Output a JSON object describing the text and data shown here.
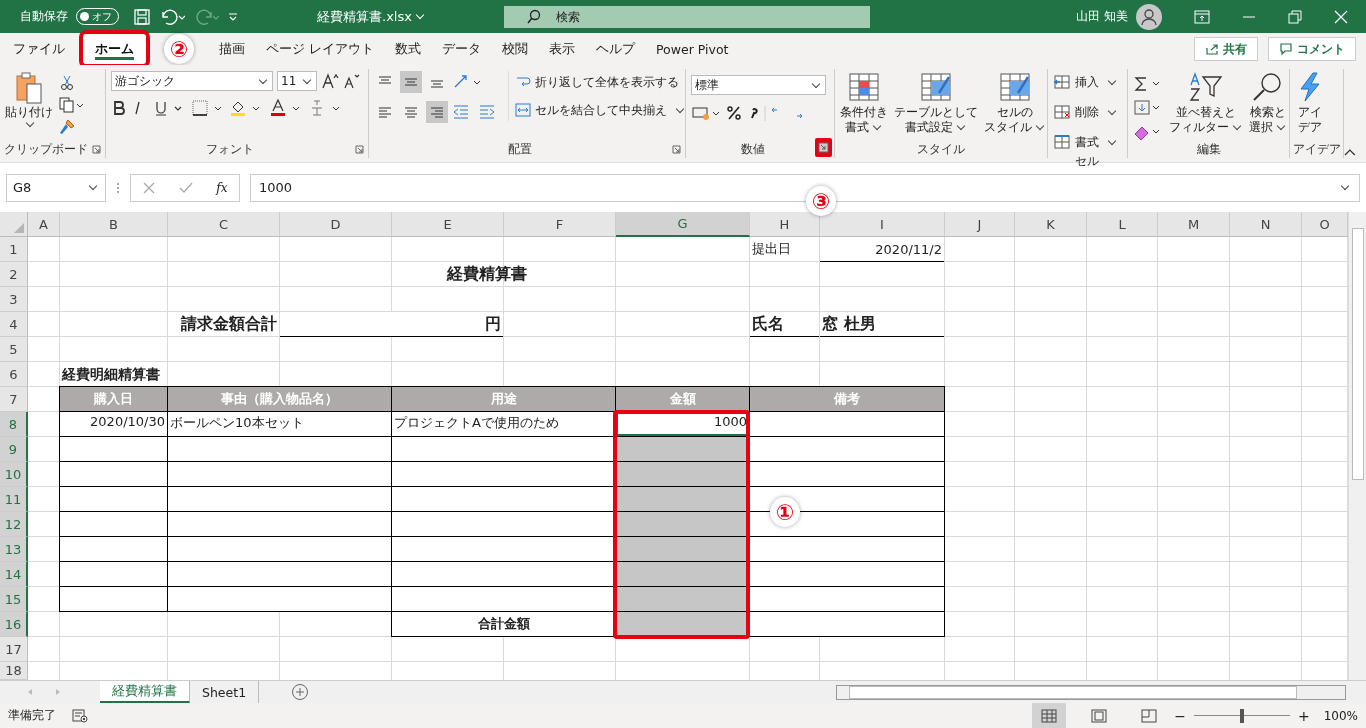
{
  "title_bar": {
    "autosave_label": "自動保存",
    "autosave_toggle": {
      "label": "オフ",
      "on": false
    },
    "file_name": "経費精算書.xlsx",
    "search": {
      "placeholder": "検索"
    },
    "user_name": "山田 知美"
  },
  "menu_tabs": [
    {
      "label": "ファイル",
      "selected": false,
      "highlighted": false
    },
    {
      "label": "ホーム",
      "selected": true,
      "highlighted": true
    },
    {
      "label": "描画",
      "selected": false,
      "highlighted": false
    },
    {
      "label": "ページ レイアウト",
      "selected": false,
      "highlighted": false
    },
    {
      "label": "数式",
      "selected": false,
      "highlighted": false
    },
    {
      "label": "データ",
      "selected": false,
      "highlighted": false
    },
    {
      "label": "校閲",
      "selected": false,
      "highlighted": false
    },
    {
      "label": "表示",
      "selected": false,
      "highlighted": false
    },
    {
      "label": "ヘルプ",
      "selected": false,
      "highlighted": false
    },
    {
      "label": "Power Pivot",
      "selected": false,
      "highlighted": false
    }
  ],
  "callouts": [
    "①",
    "②",
    "③"
  ],
  "share_button": "共有",
  "comment_button": "コメント",
  "ribbon": {
    "groups": [
      {
        "label": "クリップボード",
        "paste_label": "貼り付け"
      },
      {
        "label": "フォント",
        "font_name": "游ゴシック",
        "font_size": "11"
      },
      {
        "label": "配置",
        "wrap_text": "折り返して全体を表示する",
        "merge_center": "セルを結合して中央揃え",
        "vertical_align": [
          {
            "selected": false
          },
          {
            "selected": true
          },
          {
            "selected": false
          }
        ],
        "horizontal_align": [
          {
            "selected": false
          },
          {
            "selected": false
          },
          {
            "selected": true
          }
        ]
      },
      {
        "label": "数値",
        "number_format": "標準",
        "launcher_highlighted": true
      },
      {
        "label": "スタイル",
        "buttons": [
          {
            "lines": [
              "条件付き",
              "書式"
            ]
          },
          {
            "lines": [
              "テーブルとして",
              "書式設定"
            ]
          },
          {
            "lines": [
              "セルの",
              "スタイル"
            ]
          }
        ]
      },
      {
        "label": "セル",
        "buttons": [
          "挿入",
          "削除",
          "書式"
        ]
      },
      {
        "label": "編集",
        "buttons": [
          {
            "lines": [
              "並べ替えと",
              "フィルター"
            ]
          },
          {
            "lines": [
              "検索と",
              "選択"
            ]
          }
        ]
      },
      {
        "label": "アイデア",
        "buttons": [
          {
            "lines": [
              "アイ",
              "デア"
            ]
          }
        ]
      }
    ]
  },
  "formula_bar": {
    "name_box": "G8",
    "function_button": "fx",
    "value": "1000"
  },
  "sheet": {
    "selection_box": true,
    "columns": [
      {
        "label": "A",
        "selected": false
      },
      {
        "label": "B",
        "selected": false
      },
      {
        "label": "C",
        "selected": false
      },
      {
        "label": "D",
        "selected": false
      },
      {
        "label": "E",
        "selected": false
      },
      {
        "label": "F",
        "selected": false
      },
      {
        "label": "G",
        "selected": true
      },
      {
        "label": "H",
        "selected": false
      },
      {
        "label": "I",
        "selected": false
      },
      {
        "label": "J",
        "selected": false
      },
      {
        "label": "K",
        "selected": false
      },
      {
        "label": "L",
        "selected": false
      },
      {
        "label": "M",
        "selected": false
      },
      {
        "label": "N",
        "selected": false
      },
      {
        "label": "O",
        "selected": false
      }
    ],
    "rows": [
      {
        "label": "1",
        "selected": false,
        "cells": [
          {
            "text": "提出日",
            "kind": "label",
            "selected": false,
            "active": false
          },
          {
            "text": "2020/11/2",
            "kind": "date-underlined",
            "selected": false,
            "active": false
          }
        ]
      },
      {
        "label": "2",
        "selected": false,
        "cells": [
          {
            "text": "経費精算書",
            "kind": "title",
            "selected": false,
            "active": false
          }
        ]
      },
      {
        "label": "3",
        "selected": false
      },
      {
        "label": "4",
        "selected": false,
        "cells": [
          {
            "text": "請求金額合計",
            "kind": "heading-right",
            "selected": false,
            "active": false
          },
          {
            "text": "円",
            "kind": "unit-underlined",
            "selected": false,
            "active": false
          },
          {
            "text": "氏名",
            "kind": "heading-underlined",
            "selected": false,
            "active": false
          },
          {
            "text": "窓 杜男",
            "kind": "heading-underlined",
            "selected": false,
            "active": false
          }
        ]
      },
      {
        "label": "5",
        "selected": false
      },
      {
        "label": "6",
        "selected": false,
        "cells": [
          {
            "text": "経費明細精算書",
            "kind": "subheading",
            "selected": false,
            "active": false
          }
        ]
      },
      {
        "label": "7",
        "selected": false,
        "cells": [
          {
            "text": "購入日",
            "kind": "column-header",
            "selected": false,
            "active": false
          },
          {
            "text": "事由（購入物品名）",
            "kind": "column-header",
            "selected": false,
            "active": false
          },
          {
            "text": "用途",
            "kind": "column-header",
            "selected": false,
            "active": false
          },
          {
            "text": "金額",
            "kind": "column-header",
            "selected": false,
            "active": false
          },
          {
            "text": "備考",
            "kind": "column-header",
            "selected": false,
            "active": false
          }
        ]
      },
      {
        "label": "8",
        "selected": true,
        "cells": [
          {
            "text": "2020/10/30",
            "kind": "number-cell",
            "selected": false,
            "active": false
          },
          {
            "text": "ボールペン10本セット",
            "kind": "text-cell",
            "selected": false,
            "active": false
          },
          {
            "text": "プロジェクトAで使用のため",
            "kind": "text-cell",
            "selected": false,
            "active": false
          },
          {
            "text": "1000",
            "kind": "number-cell",
            "selected": true,
            "active": true
          },
          {
            "kind": "empty-cell",
            "selected": false,
            "active": false
          }
        ]
      },
      {
        "label": "9",
        "selected": true,
        "cells": [
          {
            "kind": "empty-cell",
            "selected": false,
            "active": false
          },
          {
            "kind": "empty-cell",
            "selected": false,
            "active": false
          },
          {
            "kind": "empty-cell",
            "selected": false,
            "active": false
          },
          {
            "kind": "empty-cell",
            "selected": true,
            "active": false
          },
          {
            "kind": "empty-cell",
            "selected": false,
            "active": false
          }
        ]
      },
      {
        "label": "10",
        "selected": true,
        "cells": [
          {
            "kind": "empty-cell",
            "selected": false,
            "active": false
          },
          {
            "kind": "empty-cell",
            "selected": false,
            "active": false
          },
          {
            "kind": "empty-cell",
            "selected": false,
            "active": false
          },
          {
            "kind": "empty-cell",
            "selected": true,
            "active": false
          },
          {
            "kind": "empty-cell",
            "selected": false,
            "active": false
          }
        ]
      },
      {
        "label": "11",
        "selected": true,
        "cells": [
          {
            "kind": "empty-cell",
            "selected": false,
            "active": false
          },
          {
            "kind": "empty-cell",
            "selected": false,
            "active": false
          },
          {
            "kind": "empty-cell",
            "selected": false,
            "active": false
          },
          {
            "kind": "empty-cell",
            "selected": true,
            "active": false
          },
          {
            "kind": "empty-cell",
            "selected": false,
            "active": false
          }
        ]
      },
      {
        "label": "12",
        "selected": true,
        "cells": [
          {
            "kind": "empty-cell",
            "selected": false,
            "active": false
          },
          {
            "kind": "empty-cell",
            "selected": false,
            "active": false
          },
          {
            "kind": "empty-cell",
            "selected": false,
            "active": false
          },
          {
            "kind": "empty-cell",
            "selected": true,
            "active": false
          },
          {
            "kind": "empty-cell",
            "selected": false,
            "active": false
          }
        ]
      },
      {
        "label": "13",
        "selected": true,
        "cells": [
          {
            "kind": "empty-cell",
            "selected": false,
            "active": false
          },
          {
            "kind": "empty-cell",
            "selected": false,
            "active": false
          },
          {
            "kind": "empty-cell",
            "selected": false,
            "active": false
          },
          {
            "kind": "empty-cell",
            "selected": true,
            "active": false
          },
          {
            "kind": "empty-cell",
            "selected": false,
            "active": false
          }
        ]
      },
      {
        "label": "14",
        "selected": true,
        "cells": [
          {
            "kind": "empty-cell",
            "selected": false,
            "active": false
          },
          {
            "kind": "empty-cell",
            "selected": false,
            "active": false
          },
          {
            "kind": "empty-cell",
            "selected": false,
            "active": false
          },
          {
            "kind": "empty-cell",
            "selected": true,
            "active": false
          },
          {
            "kind": "empty-cell",
            "selected": false,
            "active": false
          }
        ]
      },
      {
        "label": "15",
        "selected": true,
        "cells": [
          {
            "kind": "empty-cell",
            "selected": false,
            "active": false
          },
          {
            "kind": "empty-cell",
            "selected": false,
            "active": false
          },
          {
            "kind": "empty-cell",
            "selected": false,
            "active": false
          },
          {
            "kind": "empty-cell",
            "selected": true,
            "active": false
          },
          {
            "kind": "empty-cell",
            "selected": false,
            "active": false
          }
        ]
      },
      {
        "label": "16",
        "selected": true,
        "cells": [
          {
            "text": "合計金額",
            "kind": "total-label",
            "selected": false,
            "active": false
          },
          {
            "kind": "empty-cell",
            "selected": true,
            "active": false
          },
          {
            "kind": "empty-cell",
            "selected": false,
            "active": false
          }
        ]
      },
      {
        "label": "17",
        "selected": false
      },
      {
        "label": "18",
        "selected": false
      }
    ]
  },
  "sheet_tabs": [
    {
      "label": "経費精算書",
      "selected": true
    },
    {
      "label": "Sheet1",
      "selected": false
    }
  ],
  "status_bar": {
    "text": "準備完了",
    "views": [
      {
        "selected": true
      },
      {
        "selected": false
      },
      {
        "selected": false
      }
    ],
    "zoom_out": "−",
    "zoom_in": "+",
    "zoom": {
      "level": 0.5,
      "reading": "100%"
    }
  }
}
